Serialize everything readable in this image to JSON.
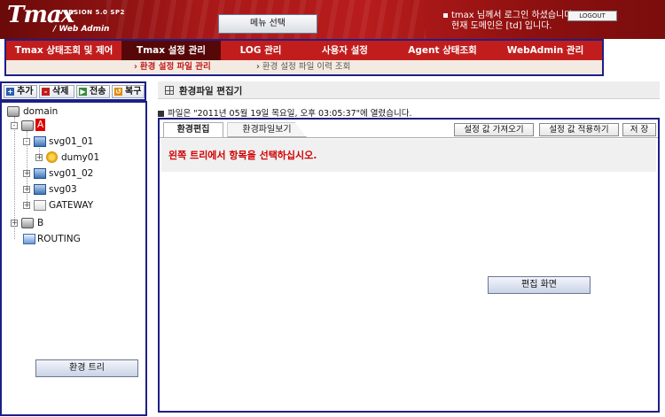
{
  "header": {
    "logo_text": "Tmax",
    "logo_version": "VERSION 5.0 SP2",
    "logo_sub": "/ Web Admin",
    "menu_button": "메뉴 선택",
    "login_line1": "tmax 님께서 로그인 하셨습니다.",
    "login_line2": "현재 도메인은 [td] 입니다.",
    "logout_button": "LOGOUT"
  },
  "nav": {
    "items": [
      {
        "label": "Tmax 상태조회 및 제어"
      },
      {
        "label": "Tmax 설정 관리"
      },
      {
        "label": "LOG 관리"
      },
      {
        "label": "사용자 설정"
      },
      {
        "label": "Agent 상태조회"
      },
      {
        "label": "WebAdmin 관리"
      }
    ],
    "subitems": [
      {
        "label": "환경 설정 파일 관리"
      },
      {
        "label": "환경 설정 파일 이력 조회"
      }
    ]
  },
  "toolbar": {
    "add": "추가",
    "delete": "삭제",
    "send": "전송",
    "restore": "복구"
  },
  "tree": {
    "root": "domain",
    "node_a": "A",
    "svg01_01": "svg01_01",
    "dumy01": "dumy01",
    "svg01_02": "svg01_02",
    "svg03": "svg03",
    "gateway": "GATEWAY",
    "node_b": "B",
    "routing": "ROUTING",
    "label_button": "환경 트리"
  },
  "editor": {
    "title": "환경파일 편집기",
    "file_info": "파일은 \"2011년 05월 19일 목요일, 오후 03:05:37\"에 열렸습니다.",
    "tab_edit": "환경편집",
    "tab_view": "환경파일보기",
    "btn_get": "설정 값 가져오기",
    "btn_apply": "설정 값 적용하기",
    "btn_save": "저 장",
    "message": "왼쪽 트리에서 항목을 선택하십시오.",
    "label_button": "편집 화면"
  },
  "colors": {
    "accent_red": "#c21d1d",
    "nav_active": "#560808",
    "annotation_border": "#1d1f86",
    "message_red": "#d20000"
  }
}
